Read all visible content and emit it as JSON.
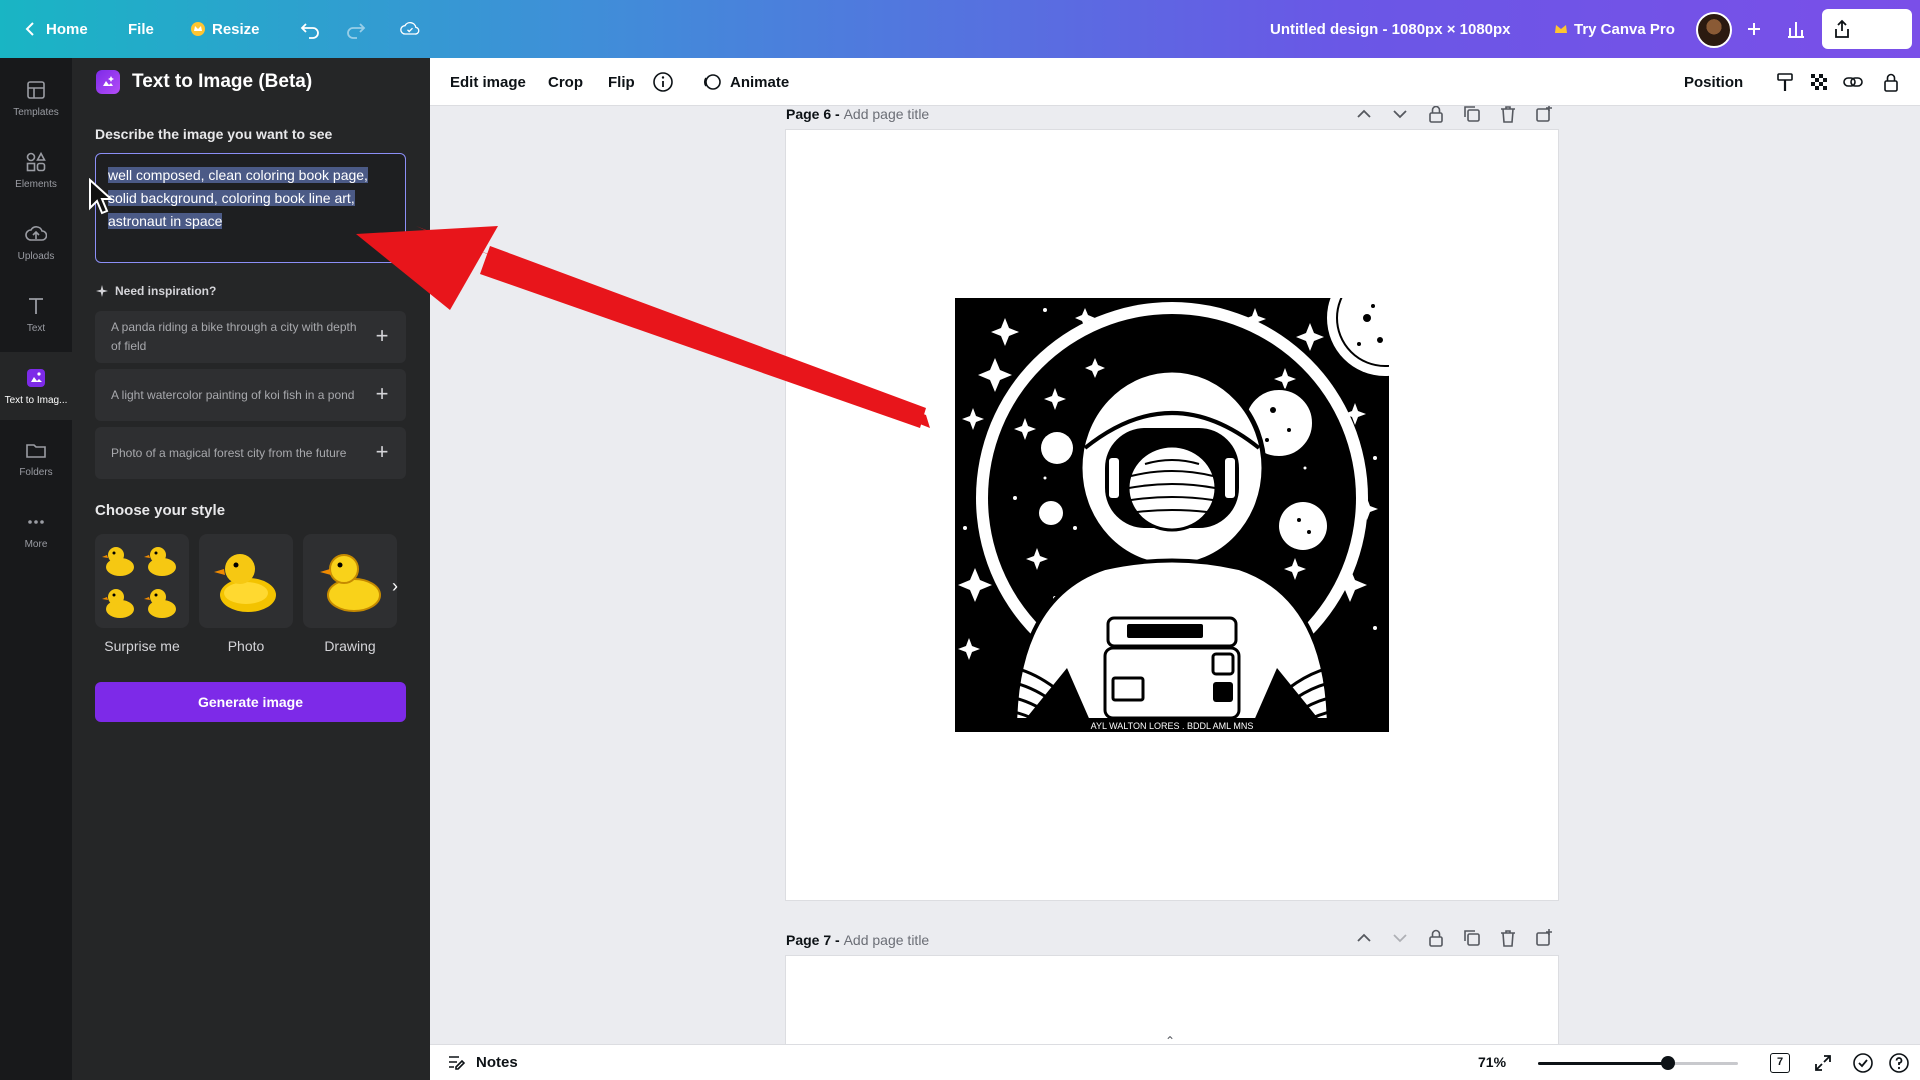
{
  "topbar": {
    "home": "Home",
    "file": "File",
    "resize": "Resize",
    "title": "Untitled design - 1080px × 1080px",
    "pro": "Try Canva Pro",
    "share": "Share"
  },
  "rail": [
    {
      "label": "Templates"
    },
    {
      "label": "Elements"
    },
    {
      "label": "Uploads"
    },
    {
      "label": "Text"
    },
    {
      "label": "Text to Imag..."
    },
    {
      "label": "Folders"
    },
    {
      "label": "More"
    }
  ],
  "panel": {
    "title": "Text to Image (Beta)",
    "describe_label": "Describe the image you want to see",
    "prompt": "well composed, clean coloring book page, solid background, coloring book line art, astronaut in space",
    "inspiration_label": "Need inspiration?",
    "inspirations": [
      "A panda riding a bike through a city with depth of field",
      "A light watercolor painting of koi fish in a pond",
      "Photo of a magical forest city from the future"
    ],
    "style_label": "Choose your style",
    "styles": [
      "Surprise me",
      "Photo",
      "Drawing"
    ],
    "generate": "Generate image"
  },
  "context": {
    "edit_image": "Edit image",
    "crop": "Crop",
    "flip": "Flip",
    "animate": "Animate",
    "position": "Position"
  },
  "pages": {
    "page6": {
      "label": "Page 6 - ",
      "sub": "Add page title"
    },
    "page7": {
      "label": "Page 7 - ",
      "sub": "Add page title"
    }
  },
  "artwork": {
    "caption": "AYL WALTON LORES . BDDL AML MNS"
  },
  "bottom": {
    "notes": "Notes",
    "zoom": "71%",
    "zoom_level": 0.65,
    "page_count": "7"
  },
  "colors": {
    "accent": "#7d2ae8",
    "arrow": "#e8151b",
    "selection": "#4b5a86"
  }
}
